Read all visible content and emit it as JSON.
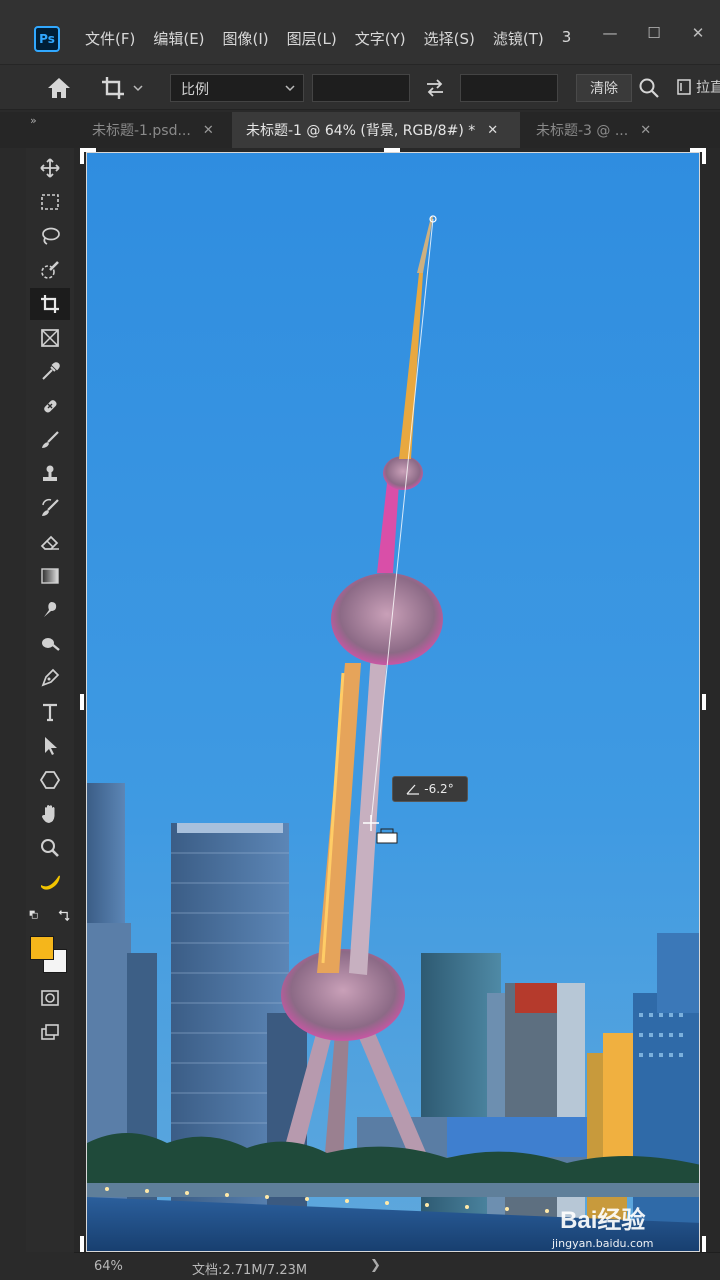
{
  "app": {
    "logo": "Ps"
  },
  "menu": [
    "文件(F)",
    "编辑(E)",
    "图像(I)",
    "图层(L)",
    "文字(Y)",
    "选择(S)",
    "滤镜(T)",
    "3"
  ],
  "window_controls": {
    "minimize": "—",
    "maximize": "☐",
    "close": "✕"
  },
  "options": {
    "ratio_value": "比例",
    "width_value": "",
    "height_value": "",
    "clear_label": "清除",
    "straighten_label": "拉直"
  },
  "tabs": [
    {
      "label": "未标题-1.psd...",
      "close": "✕",
      "active": false
    },
    {
      "label": "未标题-1 @ 64% (背景, RGB/8#) *",
      "close": "✕",
      "active": true
    },
    {
      "label": "未标题-3 @ ...",
      "close": "✕",
      "active": false
    }
  ],
  "tools": [
    "move-tool-icon",
    "marquee-tool-icon",
    "lasso-tool-icon",
    "quick-select-tool-icon",
    "crop-tool-icon",
    "frame-tool-icon",
    "eyedropper-tool-icon",
    "healing-brush-icon",
    "brush-tool-icon",
    "clone-stamp-icon",
    "history-brush-icon",
    "eraser-tool-icon",
    "gradient-tool-icon",
    "smudge-tool-icon",
    "dodge-tool-icon",
    "pen-tool-icon",
    "type-tool-icon",
    "path-select-icon",
    "shape-tool-icon",
    "hand-tool-icon",
    "zoom-tool-icon",
    "banana-icon"
  ],
  "colors": {
    "foreground": "#f5b61b",
    "background": "#f4f4f4",
    "accent": "#31a8ff"
  },
  "canvas": {
    "angle_readout": "-6.2°"
  },
  "status": {
    "zoom": "64%",
    "doc_info": "文档:2.71M/7.23M",
    "arrow": "❯"
  },
  "watermark": {
    "brand": "Bai经验",
    "url": "jingyan.baidu.com"
  }
}
